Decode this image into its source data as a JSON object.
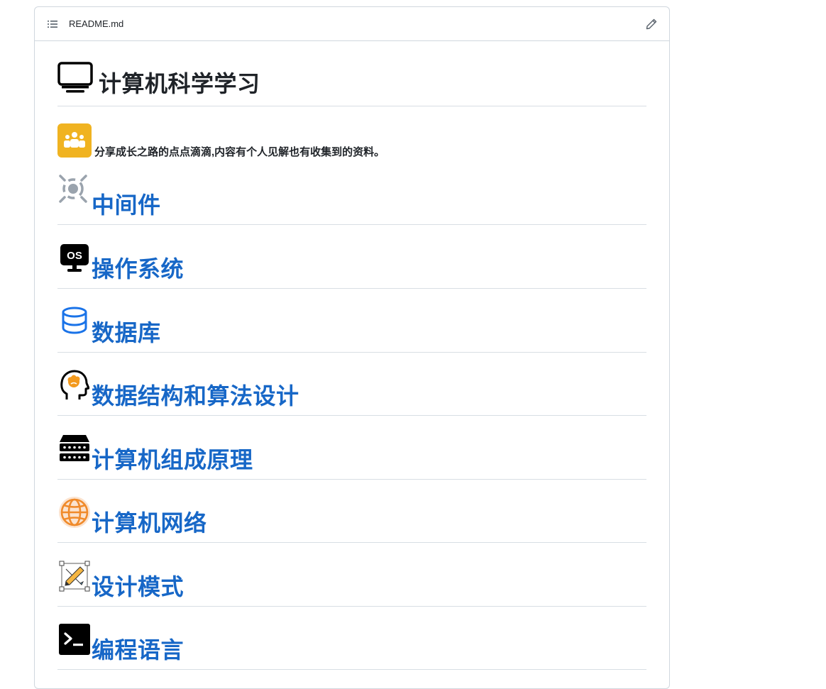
{
  "file": {
    "name": "README.md"
  },
  "title": "计算机科学学习",
  "intro": "分享成长之路的点点滴滴,内容有个人见解也有收集到的资料。",
  "sections": [
    {
      "label": "中间件",
      "icon": "middleware-icon"
    },
    {
      "label": "操作系统",
      "icon": "os-icon"
    },
    {
      "label": "数据库",
      "icon": "database-icon"
    },
    {
      "label": "数据结构和算法设计",
      "icon": "brain-icon"
    },
    {
      "label": "计算机组成原理",
      "icon": "server-rack-icon"
    },
    {
      "label": "计算机网络",
      "icon": "globe-icon"
    },
    {
      "label": "设计模式",
      "icon": "design-pencil-icon"
    },
    {
      "label": "编程语言",
      "icon": "terminal-icon"
    }
  ],
  "icon_text": {
    "os": "OS"
  },
  "colors": {
    "link": "#1767c7",
    "border": "#d0d7de",
    "intro_icon_bg": "#f0b321"
  }
}
